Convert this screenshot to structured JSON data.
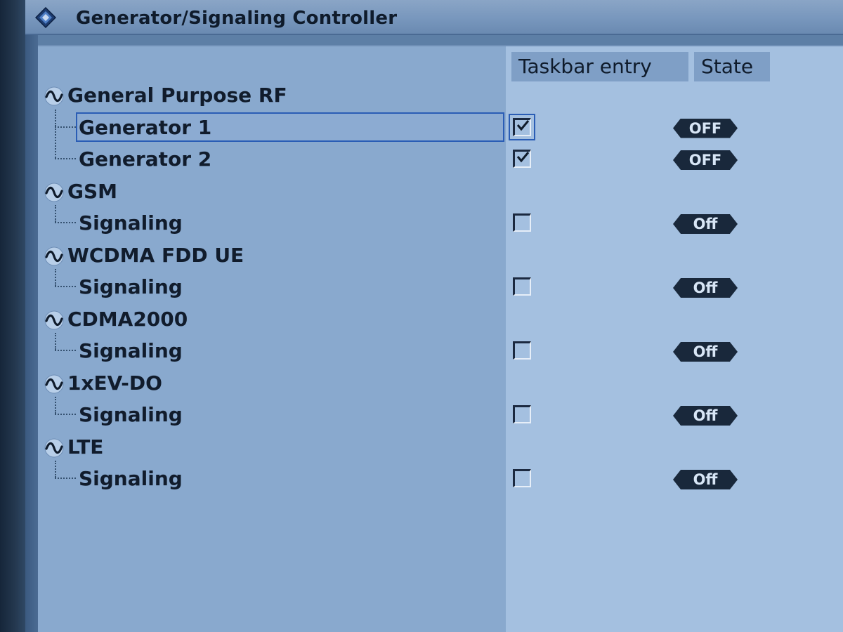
{
  "window": {
    "title": "Generator/Signaling Controller"
  },
  "columns": {
    "taskbar_entry": "Taskbar entry",
    "state": "State"
  },
  "groups": [
    {
      "label": "General Purpose RF",
      "items": [
        {
          "label": "Generator 1",
          "taskbar_checked": true,
          "state": "OFF",
          "selected": true
        },
        {
          "label": "Generator 2",
          "taskbar_checked": true,
          "state": "OFF",
          "selected": false
        }
      ]
    },
    {
      "label": "GSM",
      "items": [
        {
          "label": "Signaling",
          "taskbar_checked": false,
          "state": "Off",
          "selected": false
        }
      ]
    },
    {
      "label": "WCDMA FDD UE",
      "items": [
        {
          "label": "Signaling",
          "taskbar_checked": false,
          "state": "Off",
          "selected": false
        }
      ]
    },
    {
      "label": "CDMA2000",
      "items": [
        {
          "label": "Signaling",
          "taskbar_checked": false,
          "state": "Off",
          "selected": false
        }
      ]
    },
    {
      "label": "1xEV-DO",
      "items": [
        {
          "label": "Signaling",
          "taskbar_checked": false,
          "state": "Off",
          "selected": false
        }
      ]
    },
    {
      "label": "LTE",
      "items": [
        {
          "label": "Signaling",
          "taskbar_checked": false,
          "state": "Off",
          "selected": false
        }
      ]
    }
  ],
  "icons": {
    "app": "rohde-schwarz-diamond-icon",
    "group": "sine-wave-icon",
    "check": "checkmark-icon"
  }
}
